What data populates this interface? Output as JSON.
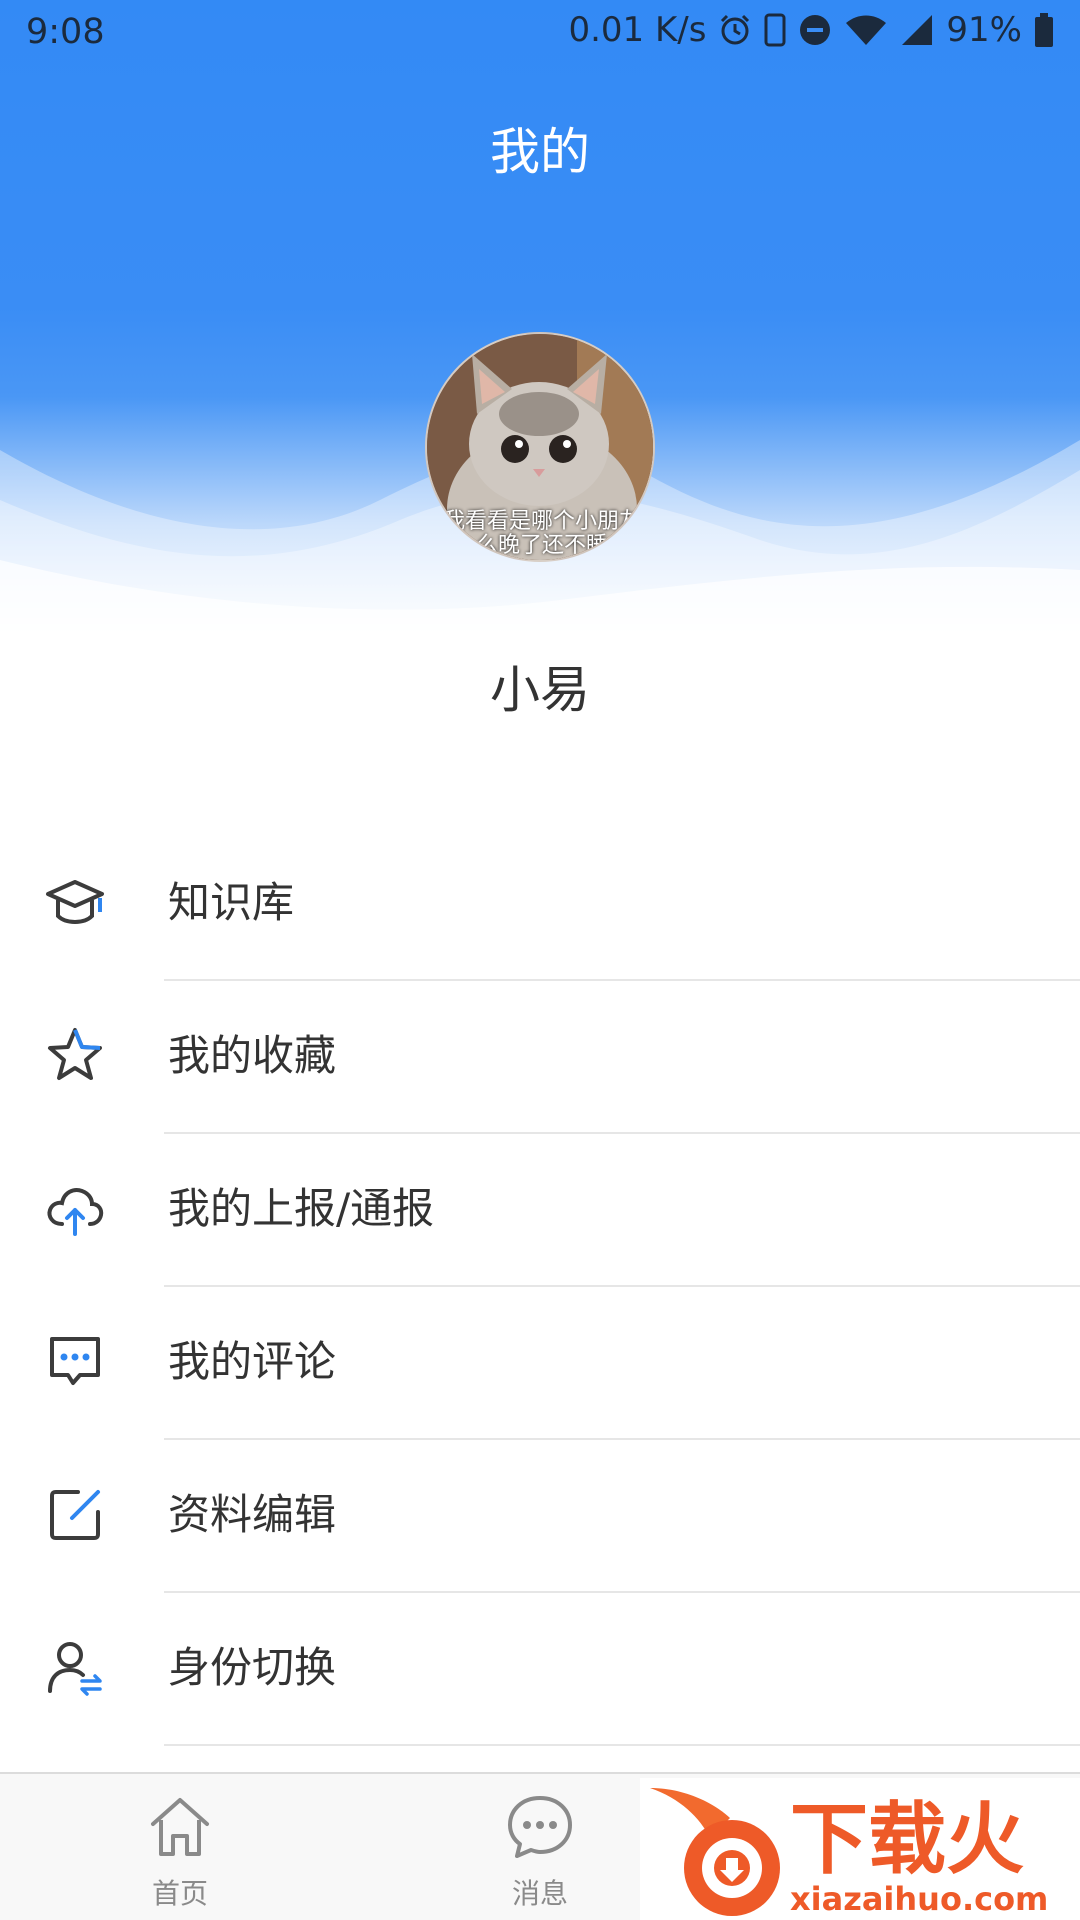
{
  "status_bar": {
    "time": "9:08",
    "network_speed": "0.01 K/s",
    "battery": "91%",
    "icons": [
      "alarm-icon",
      "phone-icon",
      "dnd-icon",
      "wifi-icon",
      "signal-icon",
      "battery-icon"
    ]
  },
  "header": {
    "title": "我的",
    "avatar_caption_line1": "我看看是哪个小朋友",
    "avatar_caption_line2": "么晚了还不睡"
  },
  "user": {
    "name": "小易"
  },
  "menu": {
    "items": [
      {
        "label": "知识库",
        "icon": "graduation-cap-icon"
      },
      {
        "label": "我的收藏",
        "icon": "star-icon"
      },
      {
        "label": "我的上报/通报",
        "icon": "cloud-upload-icon"
      },
      {
        "label": "我的评论",
        "icon": "comment-icon"
      },
      {
        "label": "资料编辑",
        "icon": "edit-icon"
      },
      {
        "label": "身份切换",
        "icon": "user-switch-icon"
      }
    ]
  },
  "tabbar": {
    "tabs": [
      {
        "label": "首页",
        "icon": "home-icon"
      },
      {
        "label": "消息",
        "icon": "message-icon"
      }
    ]
  },
  "watermark": {
    "text": "下载火",
    "url_text": "xiazaihuo.com"
  },
  "colors": {
    "accent": "#338af5",
    "icon_dark": "#3c3c3c",
    "icon_accent": "#2f86f0"
  }
}
